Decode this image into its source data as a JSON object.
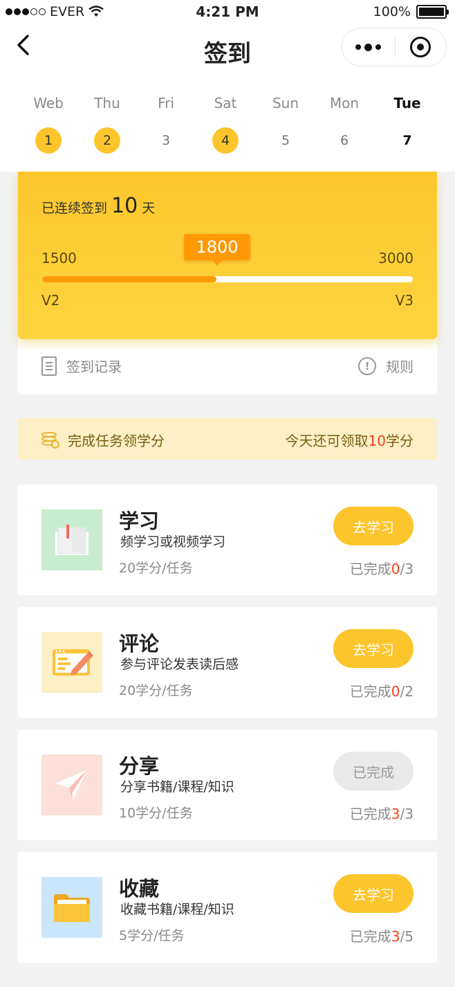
{
  "status_bar": {
    "carrier": "EVER",
    "time": "4:21 PM",
    "battery": "100%"
  },
  "nav": {
    "title": "签到"
  },
  "week": [
    {
      "name": "Web",
      "num": "1",
      "checked": true,
      "today": false
    },
    {
      "name": "Thu",
      "num": "2",
      "checked": true,
      "today": false
    },
    {
      "name": "Fri",
      "num": "3",
      "checked": false,
      "today": false
    },
    {
      "name": "Sat",
      "num": "4",
      "checked": true,
      "today": false
    },
    {
      "name": "Sun",
      "num": "5",
      "checked": false,
      "today": false
    },
    {
      "name": "Mon",
      "num": "6",
      "checked": false,
      "today": false
    },
    {
      "name": "Tue",
      "num": "7",
      "checked": false,
      "today": true
    }
  ],
  "points_card": {
    "streak_prefix": "已连续签到",
    "streak_days": "10",
    "streak_suffix": "天",
    "current_points": "1800",
    "level_min_points": "1500",
    "level_max_points": "3000",
    "level_from": "V2",
    "level_to": "V3",
    "progress_fraction": 0.47,
    "record_label": "签到记录",
    "rules_label": "规则"
  },
  "task_banner": {
    "left_label": "完成任务领学分",
    "right_prefix": "今天还可领取",
    "right_amount": "10",
    "right_suffix": "学分"
  },
  "tasks": [
    {
      "icon": "book-icon",
      "title": "学习",
      "desc": "频学习或视频学习",
      "points": "20学分/任务",
      "button": "去学习",
      "done": false,
      "progress_prefix": "已完成",
      "progress_done": "0",
      "progress_total": "/3"
    },
    {
      "icon": "comment-pencil-icon",
      "title": "评论",
      "desc": "参与评论发表读后感",
      "points": "20学分/任务",
      "button": "去学习",
      "done": false,
      "progress_prefix": "已完成",
      "progress_done": "0",
      "progress_total": "/2"
    },
    {
      "icon": "paper-plane-icon",
      "title": "分享",
      "desc": "分享书籍/课程/知识",
      "points": "10学分/任务",
      "button": "已完成",
      "done": true,
      "progress_prefix": "已完成",
      "progress_done": "3",
      "progress_total": "/3"
    },
    {
      "icon": "folder-icon",
      "title": "收藏",
      "desc": "收藏书籍/课程/知识",
      "points": "5学分/任务",
      "button": "去学习",
      "done": false,
      "progress_prefix": "已完成",
      "progress_done": "3",
      "progress_total": "/5"
    }
  ],
  "colors": {
    "accent": "#fcc52b",
    "badge": "#ff9a06",
    "highlight": "#f5411b",
    "banner_bg": "#fdf0c7"
  }
}
